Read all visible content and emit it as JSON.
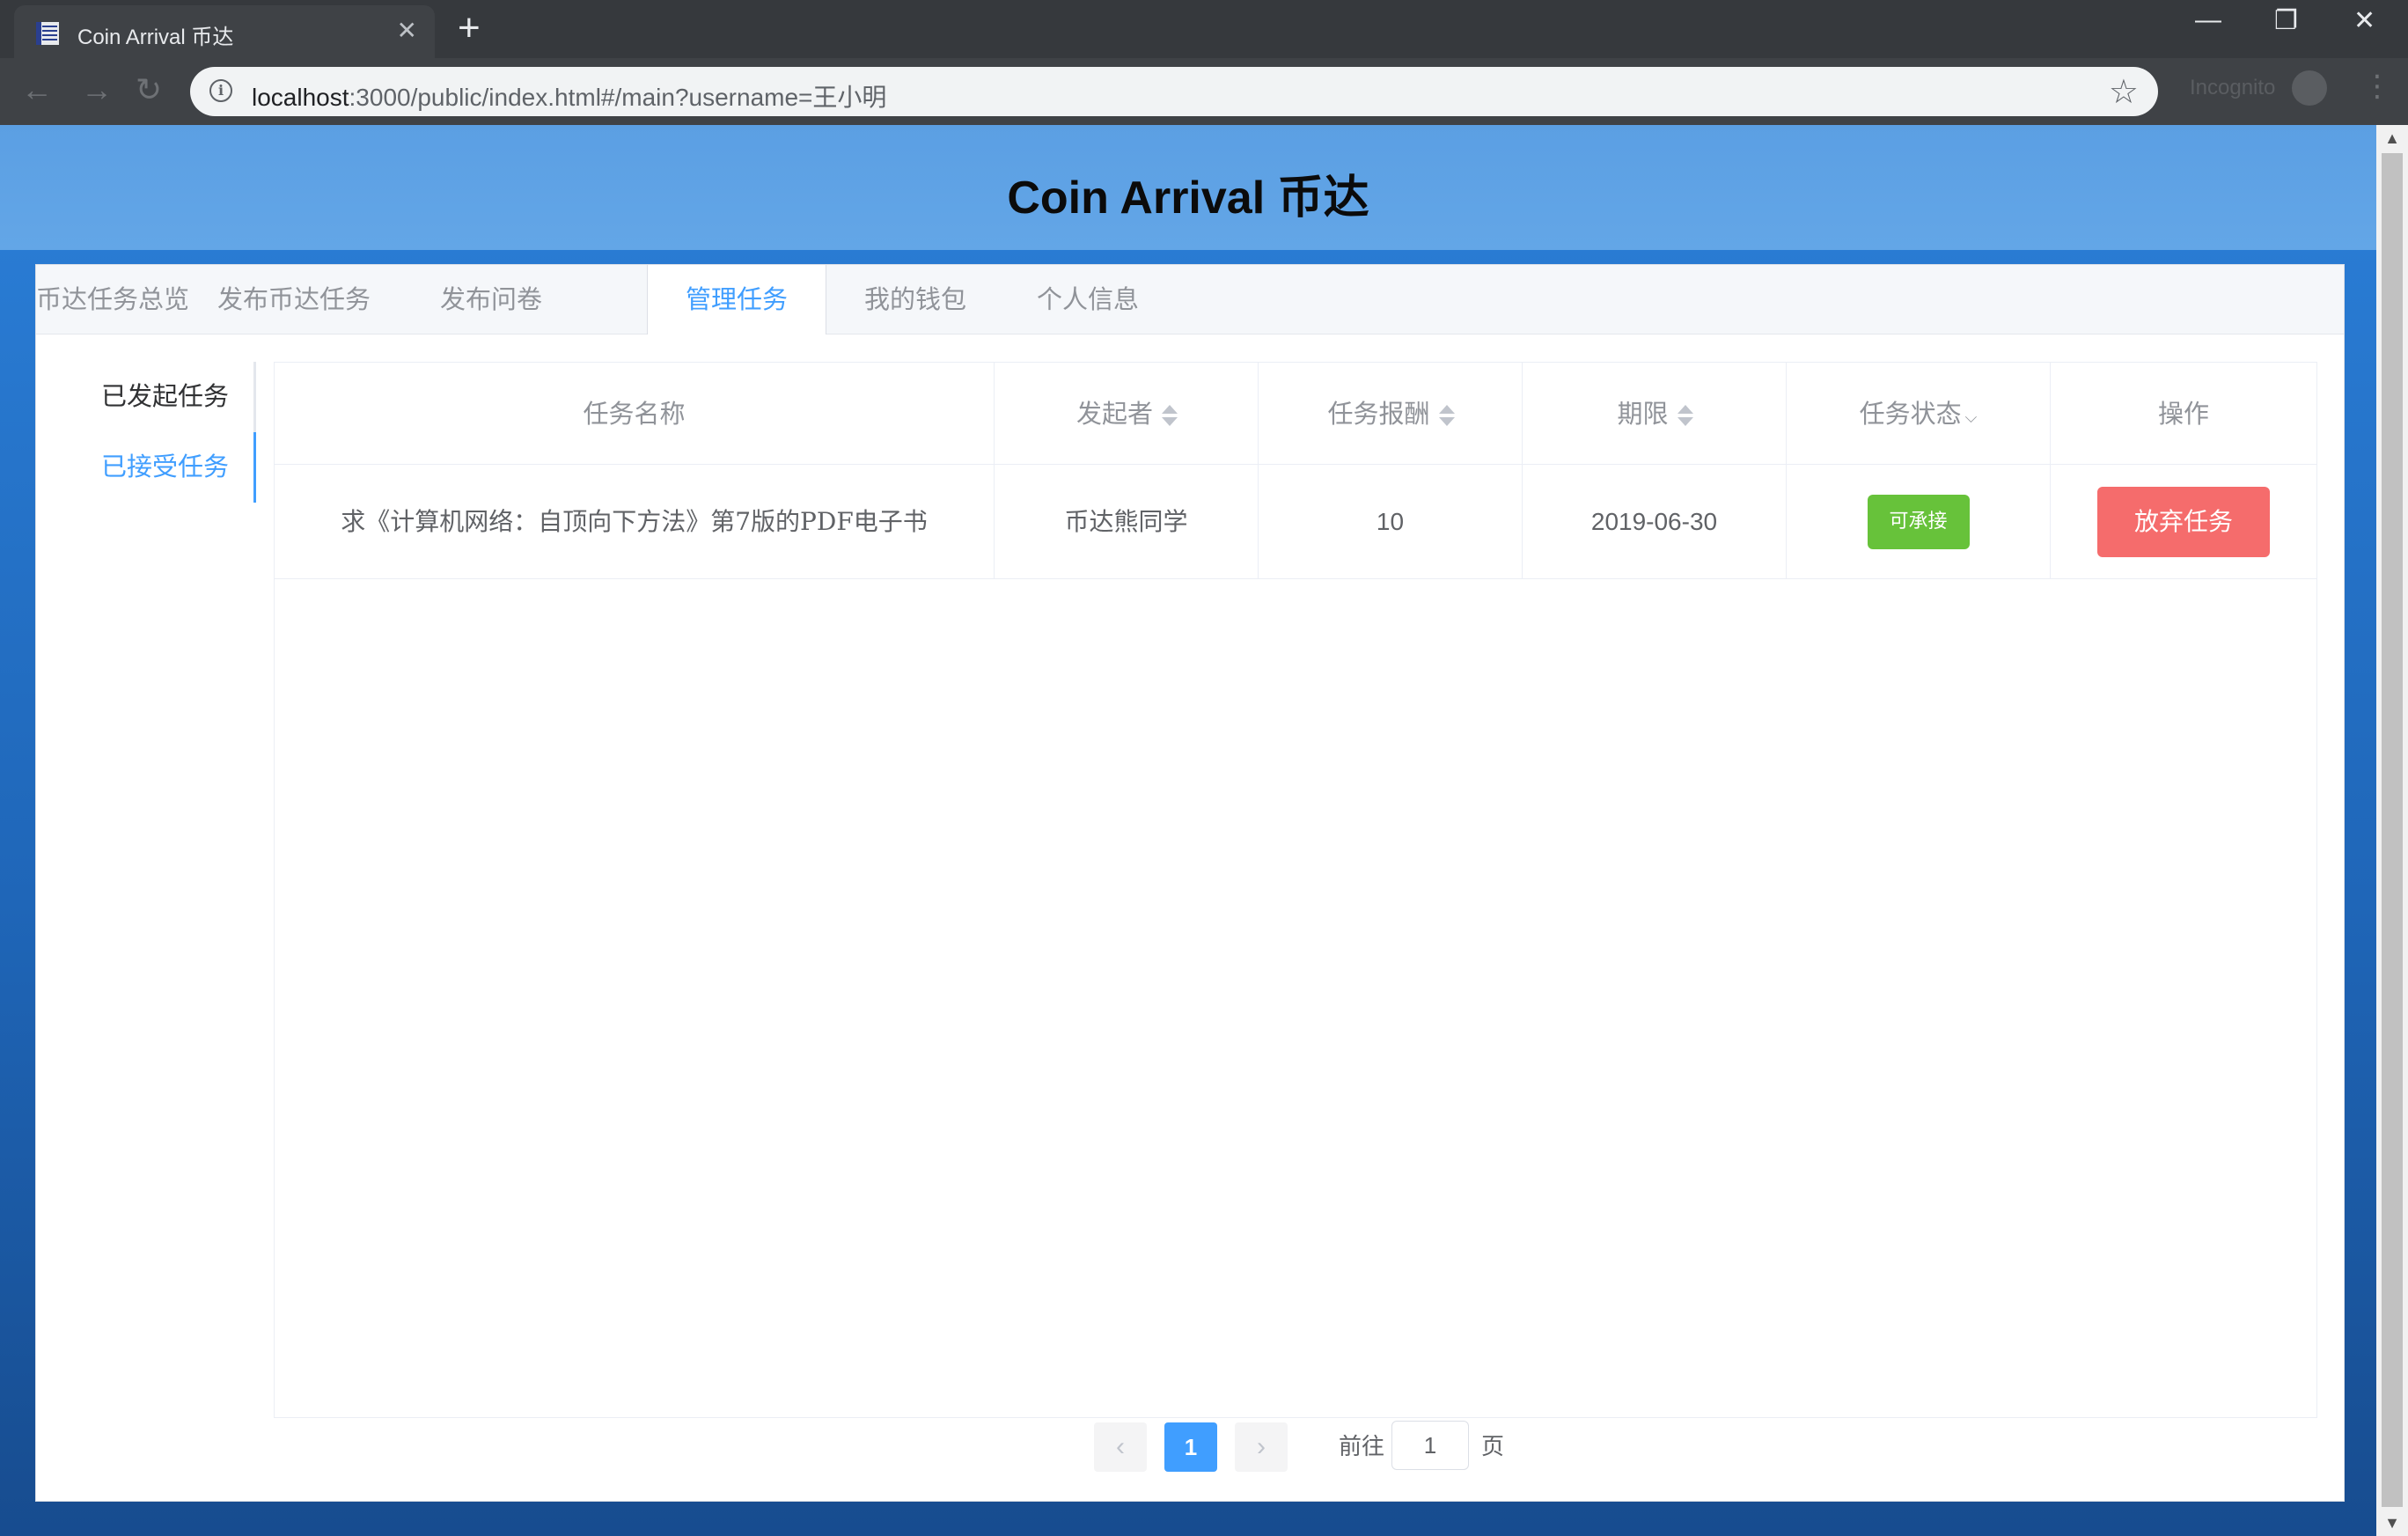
{
  "browser": {
    "tab_title": "Coin Arrival 币达",
    "url_host": "localhost",
    "url_path": ":3000/public/index.html#/main?username=王小明",
    "incognito_label": "Incognito"
  },
  "page": {
    "site_title": "Coin Arrival 币达",
    "tabs": [
      {
        "label": "币达任务总览"
      },
      {
        "label": "发布币达任务"
      },
      {
        "label": "发布问卷"
      },
      {
        "label": "管理任务",
        "active": true
      },
      {
        "label": "我的钱包"
      },
      {
        "label": "个人信息"
      }
    ],
    "side_menu": [
      {
        "label": "已发起任务"
      },
      {
        "label": "已接受任务",
        "active": true
      }
    ],
    "table": {
      "headers": [
        "任务名称",
        "发起者",
        "任务报酬",
        "期限",
        "任务状态",
        "操作"
      ],
      "rows": [
        {
          "name": "求《计算机网络：自顶向下方法》第7版的PDF电子书",
          "publisher": "币达熊同学",
          "reward": "10",
          "deadline": "2019-06-30",
          "status": "可承接",
          "action": "放弃任务"
        }
      ]
    },
    "pagination": {
      "current_page": "1",
      "goto_prefix": "前往",
      "goto_value": "1",
      "goto_suffix": "页"
    }
  },
  "colors": {
    "primary": "#409eff",
    "success": "#67c23a",
    "danger": "#f56c6c",
    "header_bg": "#5b9fe3"
  }
}
